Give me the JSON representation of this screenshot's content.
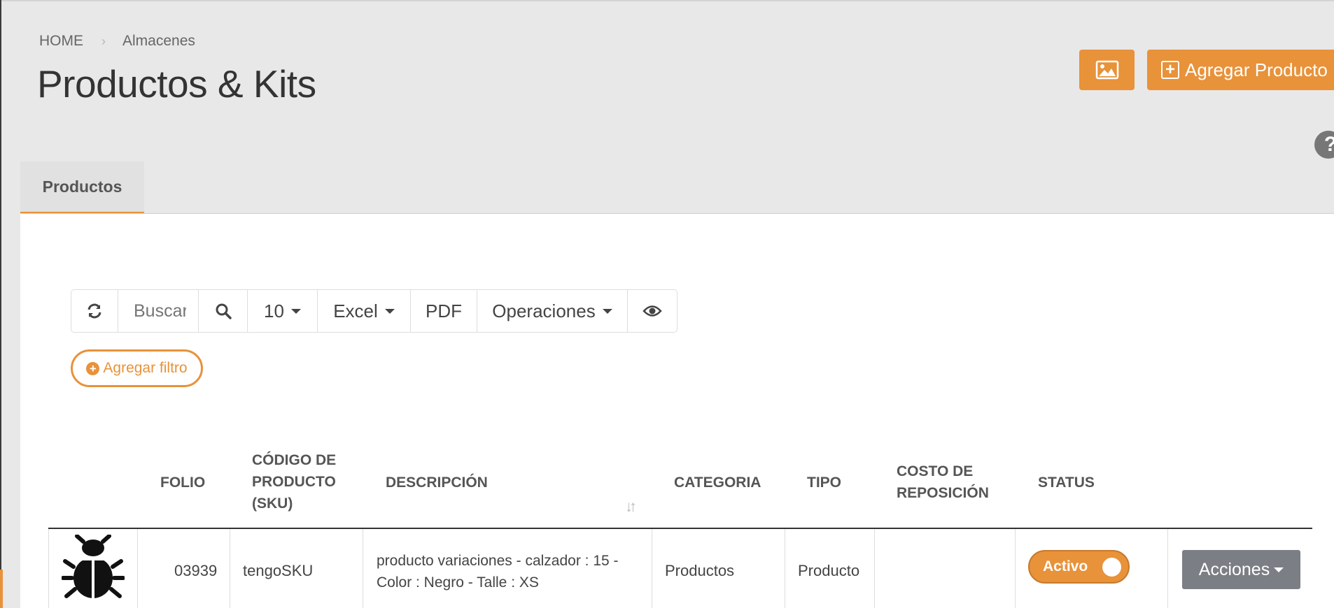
{
  "breadcrumb": {
    "home": "HOME",
    "separator": "›",
    "current": "Almacenes"
  },
  "page_title": "Productos & Kits",
  "header_actions": {
    "image_icon": "image-icon",
    "add_label": "Agregar Producto",
    "add_icon": "plus-square-icon"
  },
  "help_icon": "?",
  "tabs": [
    {
      "label": "Productos",
      "active": true
    }
  ],
  "toolbar": {
    "refresh_icon": "refresh-icon",
    "search_placeholder": "Buscar",
    "search_icon": "search-icon",
    "page_size": "10",
    "excel_label": "Excel",
    "pdf_label": "PDF",
    "operations_label": "Operaciones",
    "columns_icon": "eye-icon"
  },
  "filter": {
    "label": "Agregar filtro",
    "icon": "plus-circle-icon"
  },
  "table": {
    "headers": {
      "folio": "FOLIO",
      "sku_line1": "CÓDIGO DE",
      "sku_line2": "PRODUCTO",
      "sku_line3": "(SKU)",
      "description": "DESCRIPCIÓN",
      "category": "CATEGORIA",
      "type": "TIPO",
      "cost_line1": "COSTO DE",
      "cost_line2": "REPOSICIÓN",
      "status": "STATUS"
    },
    "rows": [
      {
        "image_icon": "bug-icon",
        "folio": "03939",
        "sku": "tengoSKU",
        "description_line1": "producto variaciones - calzador : 15 -",
        "description_line2": "Color : Negro - Talle : XS",
        "category": "Productos",
        "type": "Producto",
        "cost": "",
        "status": "Activo",
        "status_on": true,
        "actions_label": "Acciones"
      }
    ]
  },
  "colors": {
    "accent": "#e8923a",
    "actions_button": "#7b7e84",
    "page_bg": "#e8e8e8"
  }
}
